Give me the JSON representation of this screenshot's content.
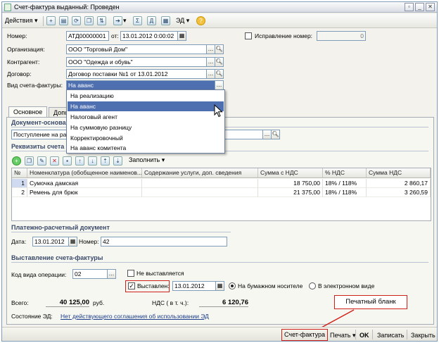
{
  "window": {
    "title": "Счет-фактура выданный: Проведен"
  },
  "toolbar": {
    "actions": "Действия",
    "fill": "Заполнить",
    "ed": "ЭД"
  },
  "header": {
    "number_label": "Номер:",
    "number": "АТД00000001",
    "from_label": "от:",
    "date": "13.01.2012 0:00:02",
    "correction_label": "Исправление номер:",
    "correction_value": "0",
    "org_label": "Организация:",
    "org": "ООО \"Торговый Дом\"",
    "contractor_label": "Контрагент:",
    "contractor": "ООО \"Одежда и обувь\"",
    "contract_label": "Договор:",
    "contract": "Договор поставки №1 от 13.01.2012",
    "kind_label": "Вид счета-фактуры:",
    "kind": "На аванс"
  },
  "dropdown": {
    "items": [
      "На реализацию",
      "На аванс",
      "Налоговый агент",
      "На суммовую разницу",
      "Корректировочный",
      "На аванс комитента"
    ],
    "selected": 1
  },
  "tabs": {
    "main": "Основное",
    "extra": "Допо"
  },
  "basis": {
    "section": "Документ-основа",
    "value": "Поступление на рас"
  },
  "requisites": {
    "section": "Реквизиты счета"
  },
  "table": {
    "headers": [
      "№",
      "Номенклатура (обобщенное наименов...",
      "Содержание услуги, доп. сведения",
      "Сумма с НДС",
      "% НДС",
      "Сумма НДС"
    ],
    "rows": [
      {
        "n": "1",
        "item": "Сумочка дамская",
        "content": "",
        "sum": "18 750,00",
        "vat_rate": "18% / 118%",
        "vat": "2 860,17"
      },
      {
        "n": "2",
        "item": "Ремень для брюк",
        "content": "",
        "sum": "21 375,00",
        "vat_rate": "18% / 118%",
        "vat": "3 260,59"
      }
    ]
  },
  "payment": {
    "section": "Платежно-расчетный документ",
    "date_label": "Дата:",
    "date": "13.01.2012",
    "number_label": "Номер:",
    "number": "42"
  },
  "issue": {
    "section": "Выставление счета-фактуры",
    "op_code_label": "Код вида операции:",
    "op_code": "02",
    "not_issued": "Не выставляется",
    "issued_label": "Выставлен:",
    "issued_date": "13.01.2012",
    "paper": "На бумажном носителе",
    "electronic": "В электронном виде"
  },
  "totals": {
    "total_label": "Всего:",
    "total": "40 125,00",
    "currency": "руб.",
    "vat_label": "НДС ( в т. ч.):",
    "vat": "6 120,76"
  },
  "ed_state": {
    "label": "Состояние ЭД:",
    "value": "Нет действующего соглашения об использовании ЭД"
  },
  "callout": {
    "text": "Печатный бланк"
  },
  "buttons": {
    "invoice": "Счет-фактура",
    "print": "Печать",
    "ok": "OK",
    "save": "Записать",
    "close": "Закрыть"
  },
  "colors": {
    "highlight": "#4e6fb0",
    "callout_border": "#d0201a",
    "selected_row": "#cfdaf0"
  }
}
